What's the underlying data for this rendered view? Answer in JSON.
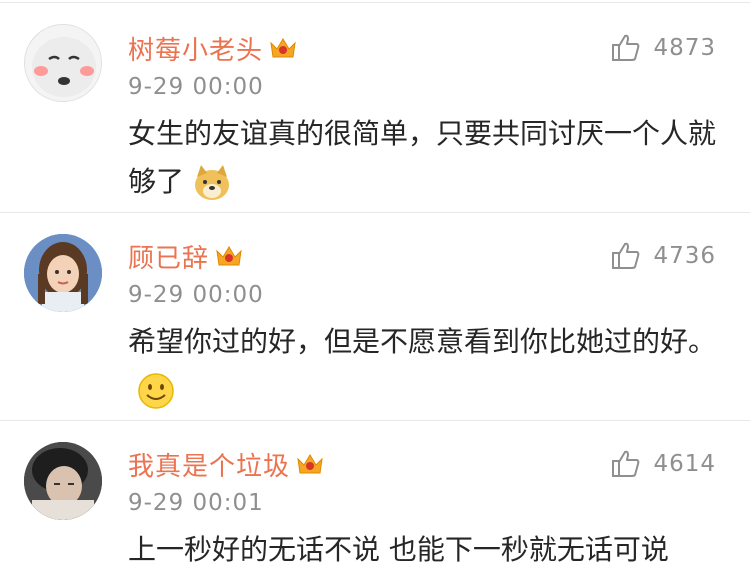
{
  "comments": [
    {
      "username": "树莓小老头",
      "timestamp": "9-29 00:00",
      "likes": "4873",
      "text": "女生的友谊真的很简单，只要共同讨厌一个人就够了",
      "emoji": "doge-emoji",
      "badge": "vip-crown-icon"
    },
    {
      "username": "顾已辞",
      "timestamp": "9-29 00:00",
      "likes": "4736",
      "text": "希望你过的好，但是不愿意看到你比她过的好。",
      "emoji": "smile-emoji",
      "badge": "vip-crown-icon"
    },
    {
      "username": "我真是个垃圾",
      "timestamp": "9-29 00:01",
      "likes": "4614",
      "text": "上一秒好的无话不说 也能下一秒就无话可说",
      "emoji": "",
      "badge": "vip-crown-icon"
    }
  ],
  "colors": {
    "username": "#eb7350",
    "meta": "#8f8f8f",
    "text": "#262626",
    "divider": "#e8e8e8",
    "badge": "#f5a623"
  }
}
